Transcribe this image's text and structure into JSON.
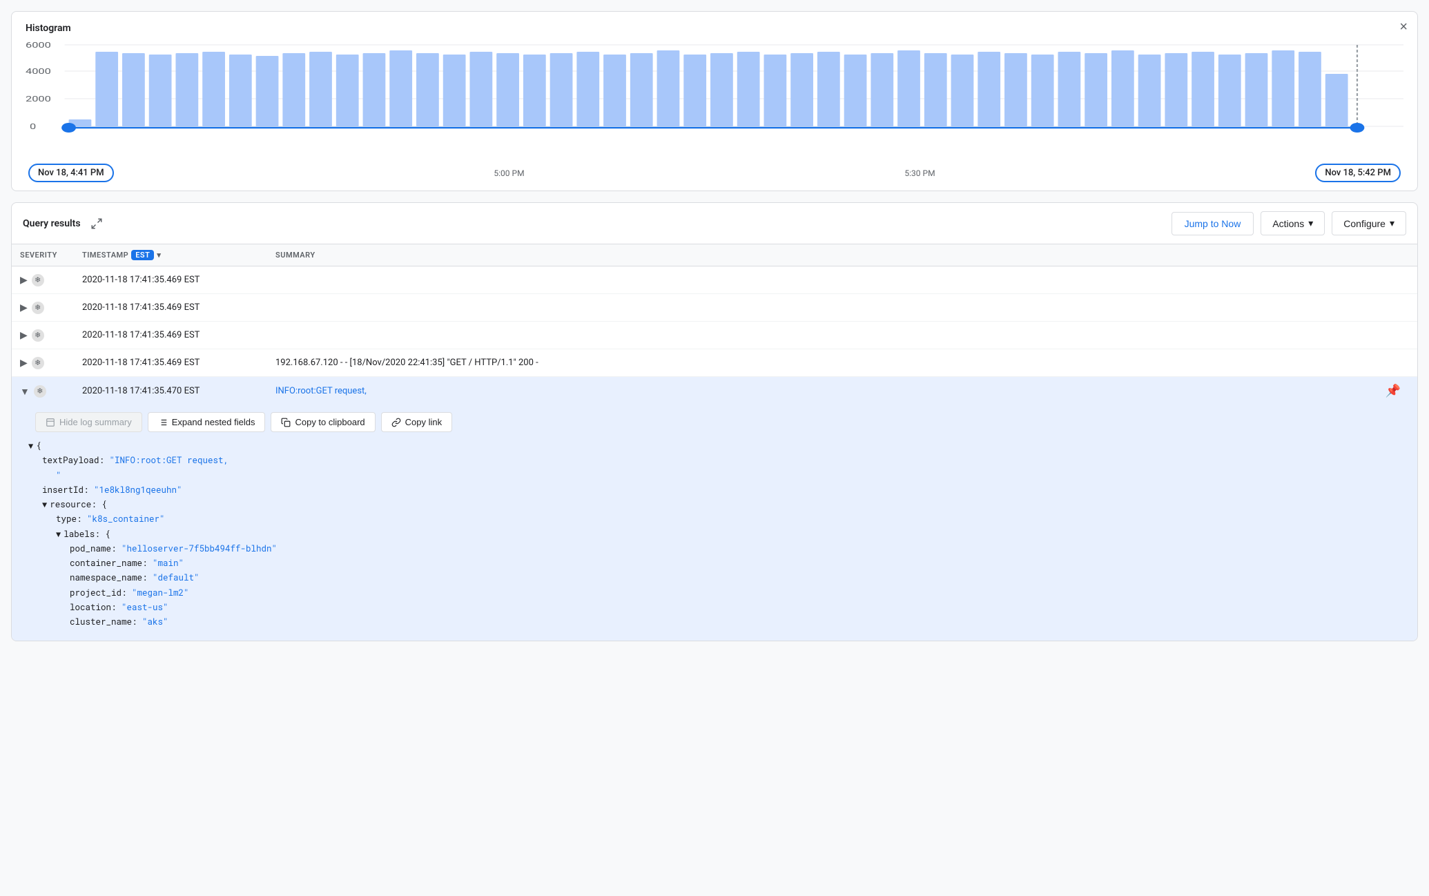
{
  "histogram": {
    "title": "Histogram",
    "close_label": "×",
    "y_labels": [
      "6000",
      "4000",
      "2000",
      "0"
    ],
    "x_labels": [
      "5:00 PM",
      "5:30 PM"
    ],
    "start_badge": "Nov 18, 4:41 PM",
    "end_badge": "Nov 18, 5:42 PM",
    "bar_color": "#a8c7fa",
    "accent_color": "#1a73e8"
  },
  "results": {
    "title": "Query results",
    "jump_to_now": "Jump to Now",
    "actions": "Actions",
    "configure": "Configure",
    "columns": {
      "severity": "SEVERITY",
      "timestamp": "TIMESTAMP",
      "timezone": "EST",
      "summary": "SUMMARY"
    },
    "rows": [
      {
        "timestamp": "2020-11-18 17:41:35.469 EST",
        "summary": ""
      },
      {
        "timestamp": "2020-11-18 17:41:35.469 EST",
        "summary": ""
      },
      {
        "timestamp": "2020-11-18 17:41:35.469 EST",
        "summary": ""
      },
      {
        "timestamp": "2020-11-18 17:41:35.469 EST",
        "summary": "192.168.67.120 - - [18/Nov/2020 22:41:35] \"GET / HTTP/1.1\" 200 -"
      }
    ],
    "expanded_row": {
      "timestamp": "2020-11-18 17:41:35.470 EST",
      "summary": "INFO:root:GET request,",
      "hide_log_summary": "Hide log summary",
      "expand_nested": "Expand nested fields",
      "copy_clipboard": "Copy to clipboard",
      "copy_link": "Copy link",
      "payload": {
        "textPayload": "\"INFO:root:GET request,\n            \"",
        "insertId": "\"1e8kl8ng1qeeuhn\"",
        "resource_type": "\"k8s_container\"",
        "labels": {
          "pod_name": "\"helloserver-7f5bb494ff-blhdn\"",
          "container_name": "\"main\"",
          "namespace_name": "\"default\"",
          "project_id": "\"megan-lm2\"",
          "location": "\"east-us\"",
          "cluster_name": "\"aks\""
        }
      }
    }
  }
}
